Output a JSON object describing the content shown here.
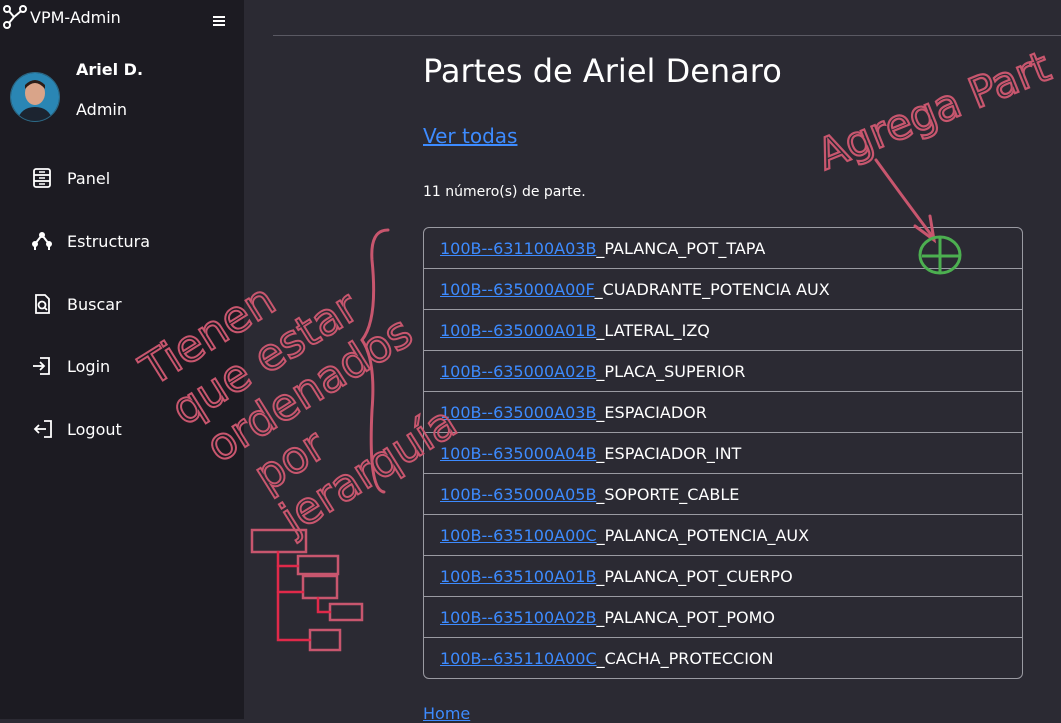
{
  "app": {
    "title": "VPM-Admin"
  },
  "user": {
    "name": "Ariel D.",
    "role": "Admin"
  },
  "sidebar": {
    "items": [
      {
        "label": "Panel",
        "icon": "panel-icon"
      },
      {
        "label": "Estructura",
        "icon": "structure-icon"
      },
      {
        "label": "Buscar",
        "icon": "search-file-icon"
      },
      {
        "label": "Login",
        "icon": "login-icon"
      },
      {
        "label": "Logout",
        "icon": "logout-icon"
      }
    ]
  },
  "main": {
    "title": "Partes de Ariel Denaro",
    "view_all": "Ver todas",
    "count_text": "11 número(s) de parte.",
    "home_link": "Home",
    "parts": [
      {
        "code": "100B--631100A03B",
        "name": "_PALANCA_POT_TAPA"
      },
      {
        "code": "100B--635000A00F",
        "name": "_CUADRANTE_POTENCIA AUX"
      },
      {
        "code": "100B--635000A01B",
        "name": "_LATERAL_IZQ"
      },
      {
        "code": "100B--635000A02B",
        "name": "_PLACA_SUPERIOR"
      },
      {
        "code": "100B--635000A03B",
        "name": "_ESPACIADOR"
      },
      {
        "code": "100B--635000A04B",
        "name": "_ESPACIADOR_INT"
      },
      {
        "code": "100B--635000A05B",
        "name": "_SOPORTE_CABLE"
      },
      {
        "code": "100B--635100A00C",
        "name": "_PALANCA_POTENCIA_AUX"
      },
      {
        "code": "100B--635100A01B",
        "name": "_PALANCA_POT_CUERPO"
      },
      {
        "code": "100B--635100A02B",
        "name": "_PALANCA_POT_POMO"
      },
      {
        "code": "100B--635110A00C",
        "name": "_CACHA_PROTECCION"
      }
    ]
  },
  "annotations": {
    "add_part": "Agrega Part",
    "ordered_note": [
      "Tienen",
      "que estar",
      "ordenados",
      "por",
      "jerarquía"
    ],
    "colors": {
      "pink": "#c8566e",
      "green": "#4caf50",
      "red": "#e0294a"
    }
  }
}
